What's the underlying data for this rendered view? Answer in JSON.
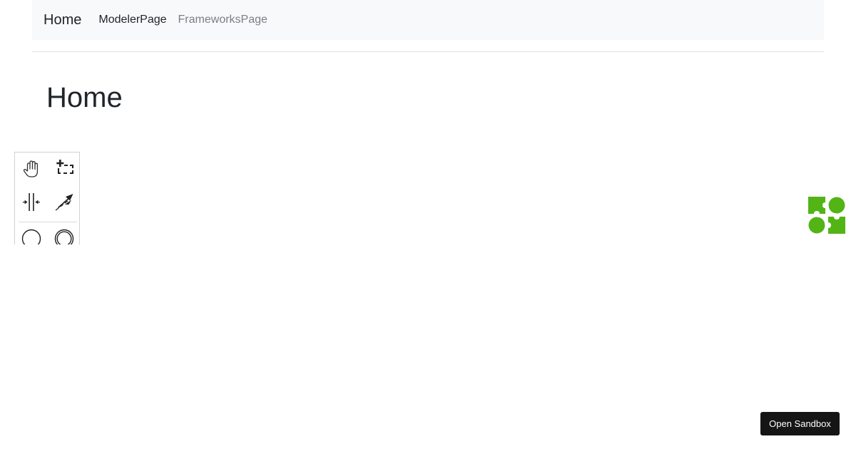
{
  "nav": {
    "brand": "Home",
    "links": [
      {
        "label": "ModelerPage",
        "state": "active"
      },
      {
        "label": "FrameworksPage",
        "state": "inactive"
      }
    ]
  },
  "main": {
    "title": "Home"
  },
  "palette": {
    "tools": [
      {
        "name": "hand-tool",
        "icon": "hand-icon"
      },
      {
        "name": "lasso-tool",
        "icon": "lasso-icon"
      },
      {
        "name": "space-tool",
        "icon": "space-icon"
      },
      {
        "name": "global-connect-tool",
        "icon": "connect-icon"
      },
      {
        "name": "create-start-event",
        "icon": "start-event-icon"
      },
      {
        "name": "create-intermediate-event",
        "icon": "intermediate-event-icon"
      }
    ]
  },
  "logo": {
    "icon": "bpmn-io-logo",
    "color": "#52b415"
  },
  "sandbox": {
    "label": "Open Sandbox"
  }
}
